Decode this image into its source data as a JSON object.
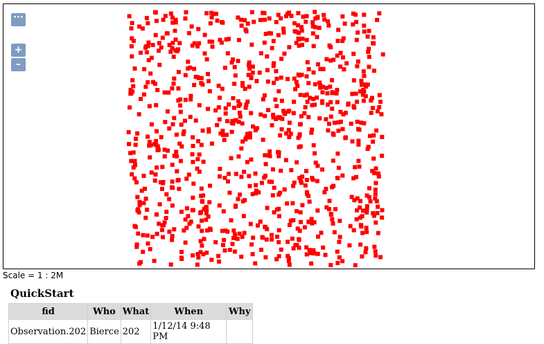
{
  "map": {
    "controls": {
      "layers_symbol": "···",
      "zoom_in_label": "+",
      "zoom_out_label": "–"
    },
    "feature_color": "#ff0000",
    "scale_text": "Scale = 1 : 2M"
  },
  "panel": {
    "title": "QuickStart",
    "columns": [
      "fid",
      "Who",
      "What",
      "When",
      "Why"
    ],
    "rows": [
      [
        "Observation.202",
        "Bierce",
        "202",
        "1/12/14 9:48 PM",
        ""
      ]
    ]
  }
}
